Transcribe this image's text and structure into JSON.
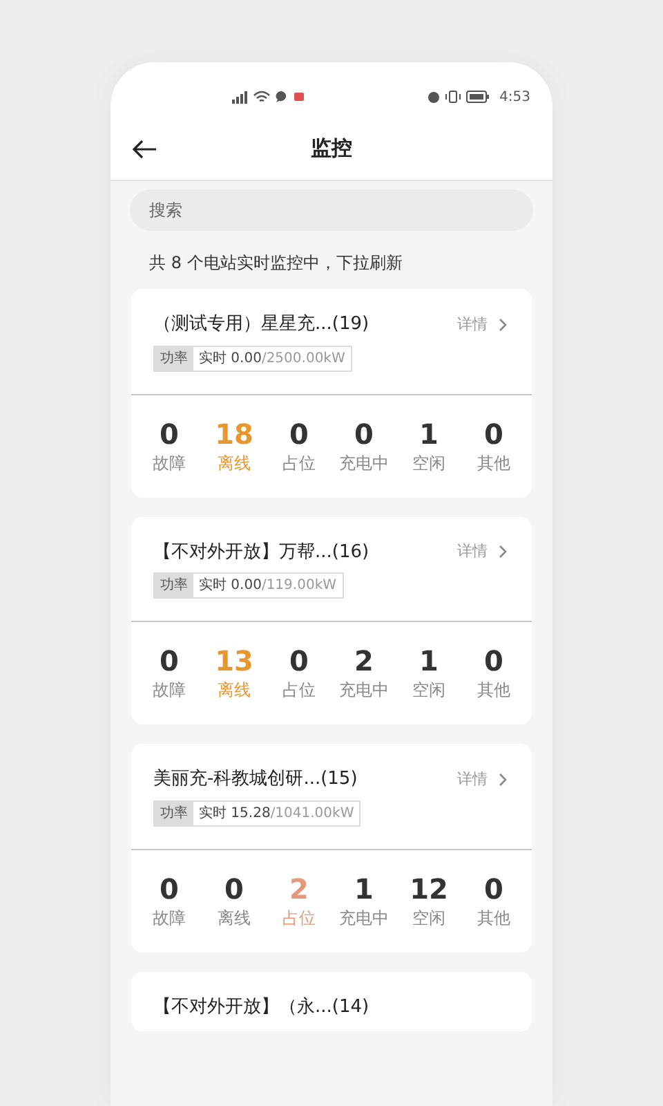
{
  "status_bar": {
    "time": "4:53"
  },
  "header": {
    "title": "监控"
  },
  "search": {
    "placeholder": "搜索"
  },
  "summary": "共 8 个电站实时监控中，下拉刷新",
  "stations": [
    {
      "title": "（测试专用）星星充...(19)",
      "details": "详情",
      "power_label": "功率",
      "realtime": "实时 0.00",
      "capacity": "/2500.00kW",
      "stats": [
        {
          "value": "0",
          "label": "故障",
          "color": "#333333"
        },
        {
          "value": "18",
          "label": "离线",
          "color": "#e8962e"
        },
        {
          "value": "0",
          "label": "占位",
          "color": "#333333"
        },
        {
          "value": "0",
          "label": "充电中",
          "color": "#333333"
        },
        {
          "value": "1",
          "label": "空闲",
          "color": "#333333"
        },
        {
          "value": "0",
          "label": "其他",
          "color": "#333333"
        }
      ]
    },
    {
      "title": "【不对外开放】万帮...(16)",
      "details": "详情",
      "power_label": "功率",
      "realtime": "实时 0.00",
      "capacity": "/119.00kW",
      "stats": [
        {
          "value": "0",
          "label": "故障",
          "color": "#333333"
        },
        {
          "value": "13",
          "label": "离线",
          "color": "#e8962e"
        },
        {
          "value": "0",
          "label": "占位",
          "color": "#333333"
        },
        {
          "value": "2",
          "label": "充电中",
          "color": "#333333"
        },
        {
          "value": "1",
          "label": "空闲",
          "color": "#333333"
        },
        {
          "value": "0",
          "label": "其他",
          "color": "#333333"
        }
      ]
    },
    {
      "title": "美丽充-科教城创研...(15)",
      "details": "详情",
      "power_label": "功率",
      "realtime": "实时 15.28",
      "capacity": "/1041.00kW",
      "stats": [
        {
          "value": "0",
          "label": "故障",
          "color": "#333333"
        },
        {
          "value": "0",
          "label": "离线",
          "color": "#333333"
        },
        {
          "value": "2",
          "label": "占位",
          "color": "#e8987a"
        },
        {
          "value": "1",
          "label": "充电中",
          "color": "#333333"
        },
        {
          "value": "12",
          "label": "空闲",
          "color": "#333333"
        },
        {
          "value": "0",
          "label": "其他",
          "color": "#333333"
        }
      ]
    },
    {
      "title": "【不对外开放】（永...(14)"
    }
  ]
}
